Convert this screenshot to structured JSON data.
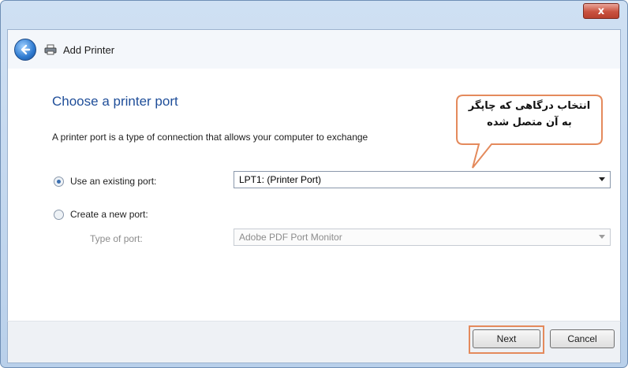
{
  "window": {
    "title": "Add Printer",
    "close_glyph": "x"
  },
  "page": {
    "heading": "Choose a printer port",
    "description": "A printer port is a type of connection that allows your computer to exchange"
  },
  "options": {
    "existing": {
      "label": "Use an existing port:",
      "selected": true,
      "value": "LPT1: (Printer Port)"
    },
    "create": {
      "label": "Create a new port:",
      "selected": false,
      "type_label": "Type of port:",
      "type_value": "Adobe PDF Port Monitor"
    }
  },
  "buttons": {
    "next": "Next",
    "cancel": "Cancel"
  },
  "callout": {
    "line1": "انتخاب درگاهی که چاپگر",
    "line2": "به آن متصل شده"
  },
  "colors": {
    "heading": "#1f4e99",
    "highlight": "#e48a5c"
  }
}
